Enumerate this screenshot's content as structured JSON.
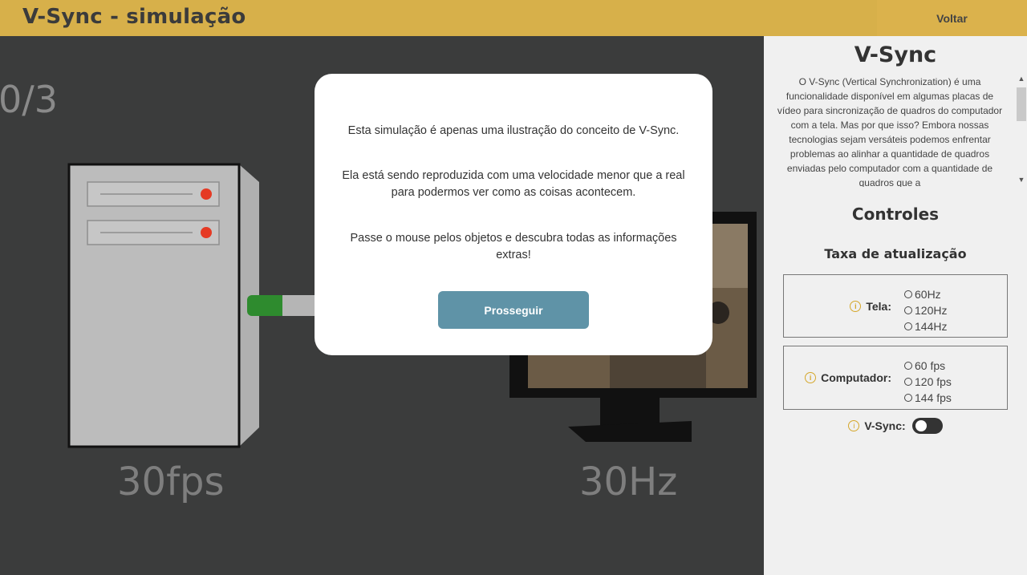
{
  "header": {
    "title": "V-Sync - simulação",
    "back_label": "Voltar"
  },
  "stage": {
    "counter": "0/3",
    "computer_label": "30fps",
    "monitor_label": "30Hz"
  },
  "panel": {
    "title": "V-Sync",
    "description": "O V-Sync (Vertical Synchronization) é uma funcionalidade disponível em algumas placas de vídeo para sincronização de quadros do computador com a tela. Mas por que isso? Embora nossas tecnologias sejam versáteis podemos enfrentar problemas ao alinhar a quantidade de quadros enviadas pelo computador com a quantidade de quadros que a",
    "controls_title": "Controles",
    "rate_title": "Taxa de atualização",
    "screen": {
      "label": "Tela:",
      "options": [
        "60Hz",
        "120Hz",
        "144Hz"
      ]
    },
    "computer": {
      "label": "Computador:",
      "options": [
        "60 fps",
        "120 fps",
        "144 fps"
      ]
    },
    "vsync": {
      "label": "V-Sync:",
      "enabled": false
    },
    "info_icon": "info-icon"
  },
  "modal": {
    "p1": "Esta simulação é apenas uma ilustração do conceito de V-Sync.",
    "p2": "Ela está sendo reproduzida com uma velocidade menor que a real para podermos ver como as coisas acontecem.",
    "p3": "Passe o mouse pelos objetos e descubra todas as informações extras!",
    "button_label": "Prosseguir"
  },
  "colors": {
    "header": "#d7b04a",
    "stage_bg": "#3b3c3c",
    "panel_bg": "#f0f0f0",
    "button": "#5f93a7",
    "info_icon": "#d5a72a",
    "led": "#e53a24",
    "cable_green": "#2e8b2e"
  }
}
